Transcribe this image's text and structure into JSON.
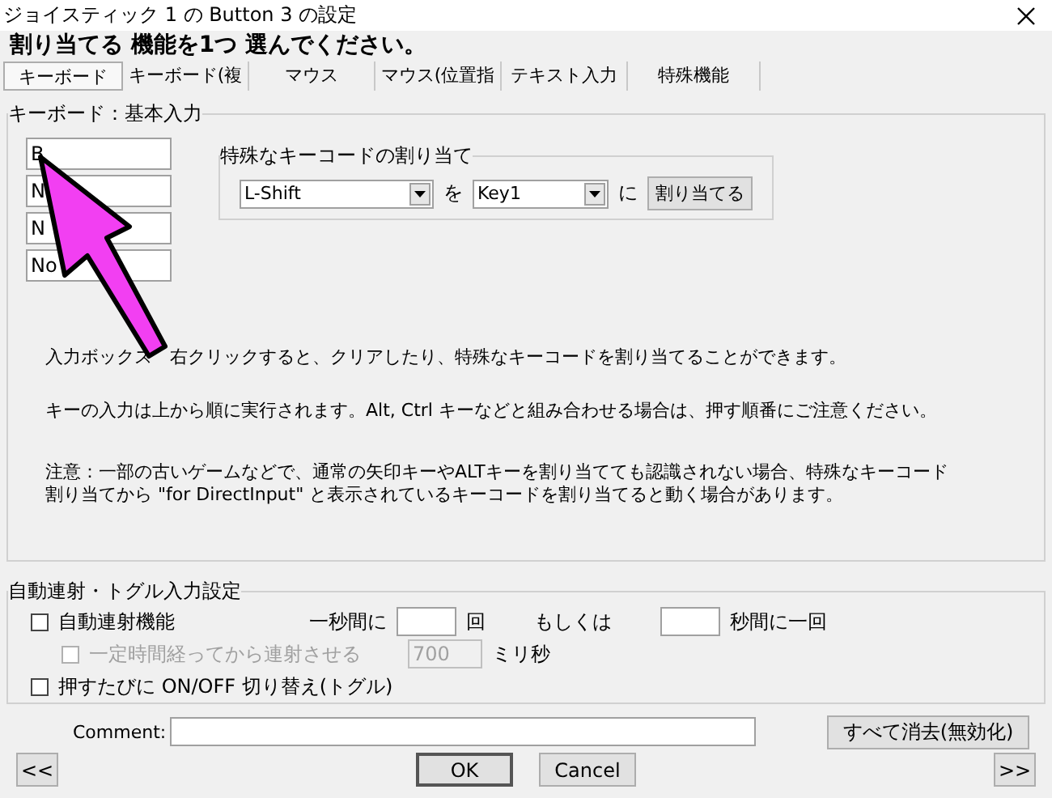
{
  "window": {
    "title": "ジョイスティック 1 の Button 3 の設定"
  },
  "instruction": "割り当てる 機能を1つ 選んでください。",
  "tabs": [
    {
      "label": "キーボード",
      "selected": true
    },
    {
      "label": "キーボード(複",
      "selected": false
    },
    {
      "label": "マウス",
      "selected": false
    },
    {
      "label": "マウス(位置指",
      "selected": false
    },
    {
      "label": "テキスト入力",
      "selected": false
    },
    {
      "label": "特殊機能",
      "selected": false
    }
  ],
  "keyboard_group": {
    "title": "キーボード：基本入力",
    "key_inputs": [
      "B",
      "N",
      "N",
      "No"
    ],
    "special_key": {
      "title": "特殊なキーコードの割り当て",
      "key": "L-Shift",
      "connector_1": "を",
      "target": "Key1",
      "connector_2": "に",
      "button": "割り当てる"
    },
    "notes": [
      "入力ボックス　右クリックすると、クリアしたり、特殊なキーコードを割り当てることができます。",
      "キーの入力は上から順に実行されます。Alt, Ctrl キーなどと組み合わせる場合は、押す順番にご注意ください。",
      "注意：一部の古いゲームなどで、通常の矢印キーやALTキーを割り当てても認識されない場合、特殊なキーコード",
      "割り当てから \"for DirectInput\" と表示されているキーコードを割り当てると動く場合があります。"
    ]
  },
  "auto_group": {
    "title": "自動連射・トグル入力設定",
    "autofire": {
      "label": "自動連射機能",
      "checked": false,
      "per_second": "一秒間に",
      "count_unit": "回",
      "or": "もしくは",
      "seconds_unit": "秒間に一回"
    },
    "delay": {
      "label": "一定時間経ってから連射させる",
      "checked": false,
      "disabled": true,
      "value": "700",
      "unit": "ミリ秒"
    },
    "toggle": {
      "label": "押すたびに ON/OFF 切り替え(トグル)",
      "checked": false
    }
  },
  "comment": {
    "label": "Comment:"
  },
  "clear_button": "すべて消去(無効化)",
  "buttons": {
    "prev": "<<",
    "ok": "OK",
    "cancel": "Cancel",
    "next": ">>"
  }
}
